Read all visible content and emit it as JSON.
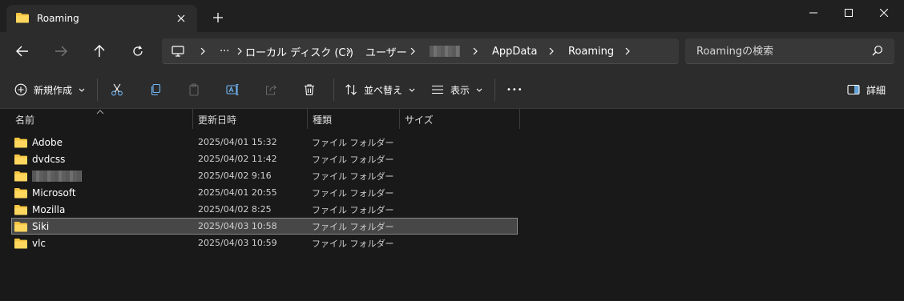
{
  "tab": {
    "title": "Roaming"
  },
  "address": {
    "ellipsis": "···",
    "crumbs": [
      "ローカル ディスク (C:)",
      "ユーザー",
      "",
      "AppData",
      "Roaming"
    ]
  },
  "search": {
    "placeholder": "Roamingの検索"
  },
  "toolbar": {
    "new_label": "新規作成",
    "sort_label": "並べ替え",
    "view_label": "表示",
    "more_label": "•••",
    "details_label": "詳細"
  },
  "columns": {
    "name": "名前",
    "date": "更新日時",
    "type": "種類",
    "size": "サイズ"
  },
  "files": [
    {
      "name": "Adobe",
      "date": "2025/04/01 15:32",
      "type": "ファイル フォルダー"
    },
    {
      "name": "dvdcss",
      "date": "2025/04/02 11:42",
      "type": "ファイル フォルダー"
    },
    {
      "name": "",
      "date": "2025/04/02 9:16",
      "type": "ファイル フォルダー"
    },
    {
      "name": "Microsoft",
      "date": "2025/04/01 20:55",
      "type": "ファイル フォルダー"
    },
    {
      "name": "Mozilla",
      "date": "2025/04/02 8:25",
      "type": "ファイル フォルダー"
    },
    {
      "name": "Siki",
      "date": "2025/04/03 10:58",
      "type": "ファイル フォルダー"
    },
    {
      "name": "vlc",
      "date": "2025/04/03 10:59",
      "type": "ファイル フォルダー"
    }
  ],
  "selected_index": 5,
  "colors": {
    "folder": "#f5c542",
    "background": "#191919",
    "chrome": "#2c2c2c",
    "accent": "#6fb6f5"
  }
}
